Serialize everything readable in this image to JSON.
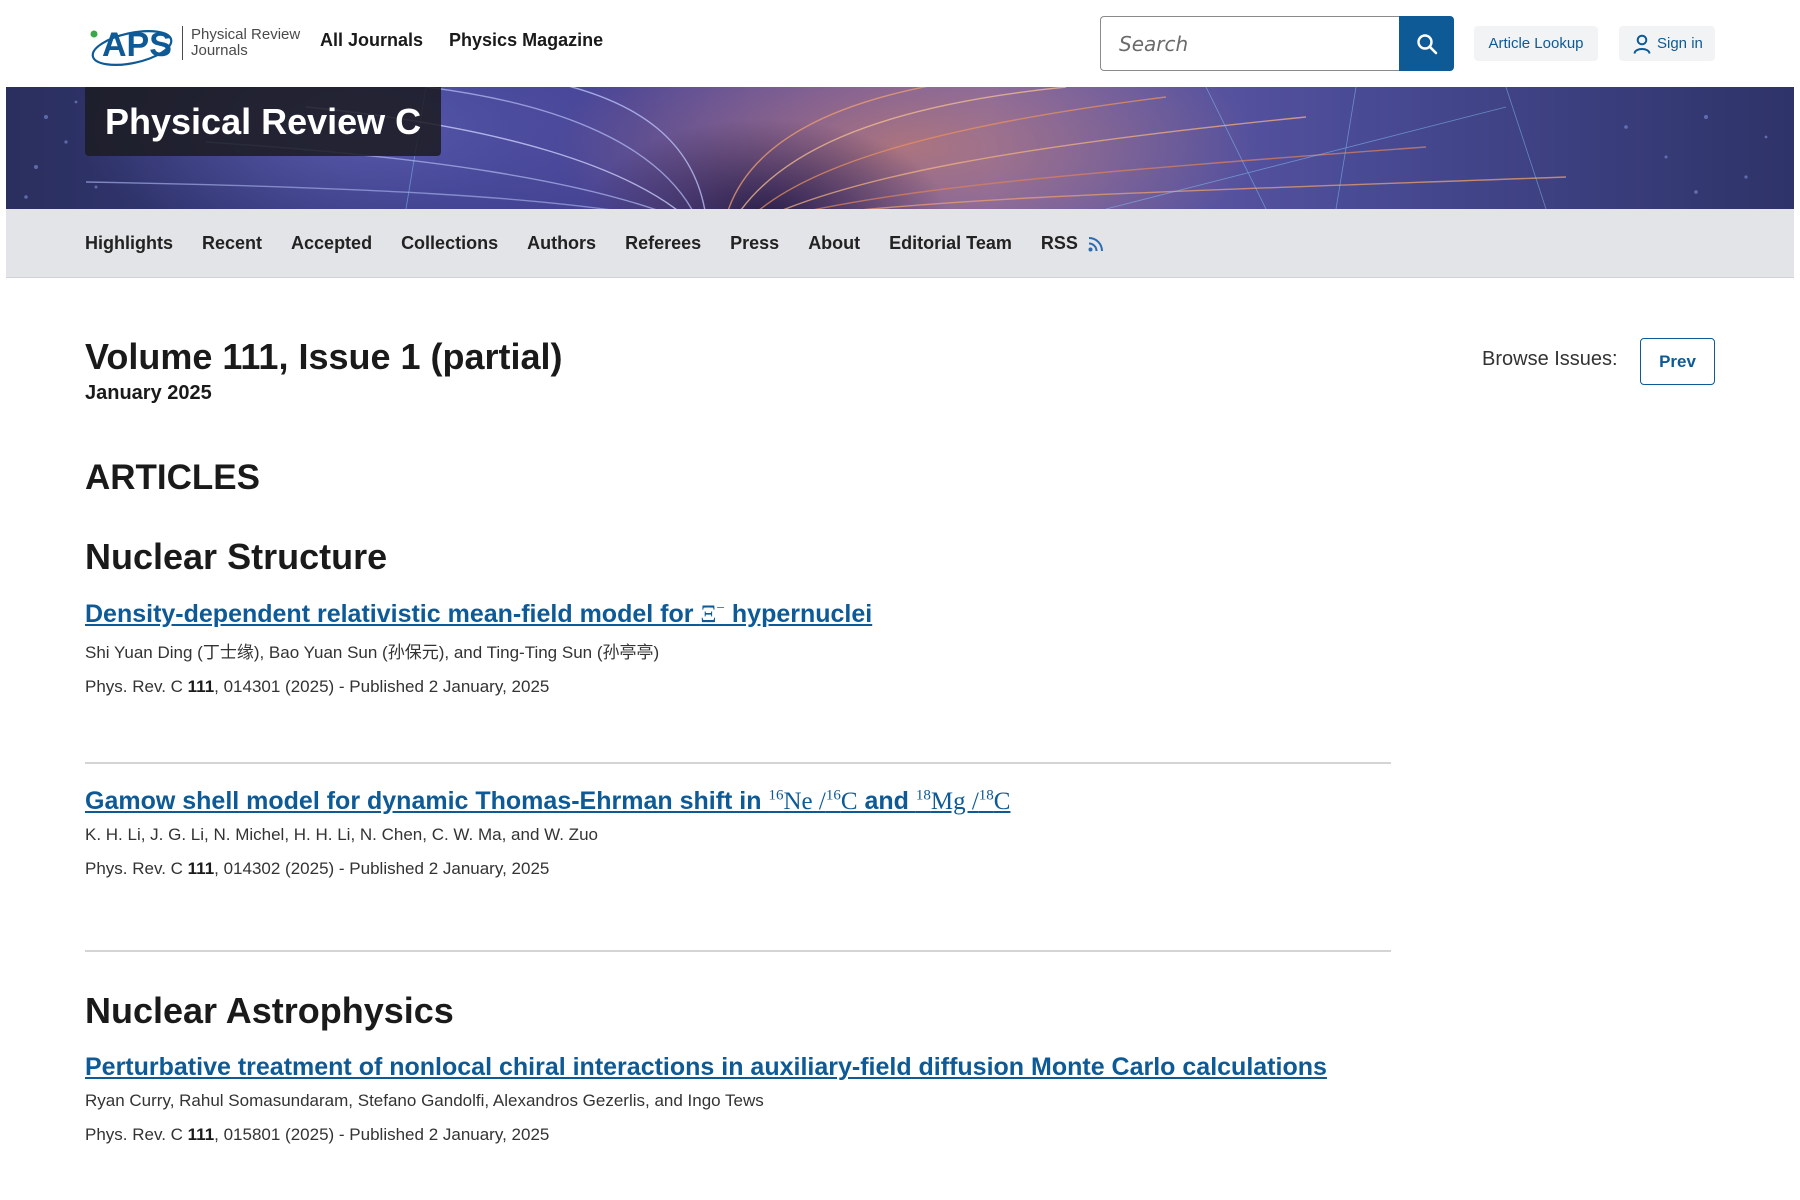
{
  "header": {
    "logo_text": "APS",
    "logo_subtitle_line1": "Physical Review",
    "logo_subtitle_line2": "Journals",
    "nav": [
      "All Journals",
      "Physics Magazine"
    ],
    "search_placeholder": "Search",
    "article_lookup": "Article Lookup",
    "sign_in": "Sign in"
  },
  "banner": {
    "journal_title": "Physical Review C"
  },
  "subnav": {
    "items": [
      "Highlights",
      "Recent",
      "Accepted",
      "Collections",
      "Authors",
      "Referees",
      "Press",
      "About",
      "Editorial Team"
    ],
    "rss": "RSS"
  },
  "issue": {
    "title": "Volume 111, Issue 1 (partial)",
    "date": "January 2025",
    "browse_label": "Browse Issues:",
    "prev": "Prev"
  },
  "content": {
    "articles_heading": "ARTICLES",
    "sections": [
      {
        "heading": "Nuclear Structure",
        "articles": [
          {
            "title_prefix": "Density-dependent relativistic mean-field model for ",
            "title_math": "Ξ",
            "title_math_sup": "−",
            "title_suffix": " hypernuclei",
            "authors": "Shi Yuan Ding (丁士缘), Bao Yuan Sun (孙保元), and Ting-Ting Sun (孙亭亭)",
            "journal": "Phys. Rev. C ",
            "volume": "111",
            "citation_rest": ", 014301 (2025) - Published 2 January, 2025"
          },
          {
            "title_prefix": "Gamow shell model for dynamic Thomas-Ehrman shift in ",
            "math1_sup": "16",
            "math1_base": "Ne /",
            "math2_sup": "16",
            "math2_base": "C",
            "title_mid": " and ",
            "math3_sup": "18",
            "math3_base": "Mg /",
            "math4_sup": "18",
            "math4_base": "C",
            "authors": "K. H. Li, J. G. Li, N. Michel, H. H. Li, N. Chen, C. W. Ma, and W. Zuo",
            "journal": "Phys. Rev. C ",
            "volume": "111",
            "citation_rest": ", 014302 (2025) - Published 2 January, 2025"
          }
        ]
      },
      {
        "heading": "Nuclear Astrophysics",
        "articles": [
          {
            "title": "Perturbative treatment of nonlocal chiral interactions in auxiliary-field diffusion Monte Carlo calculations",
            "authors": "Ryan Curry, Rahul Somasundaram, Stefano Gandolfi, Alexandros Gezerlis, and Ingo Tews",
            "journal": "Phys. Rev. C ",
            "volume": "111",
            "citation_rest": ", 015801 (2025) - Published 2 January, 2025"
          }
        ]
      }
    ]
  },
  "colors": {
    "link": "#0d5a96",
    "search_button": "#0d5a96",
    "subnav_bg": "#e3e4e8"
  }
}
